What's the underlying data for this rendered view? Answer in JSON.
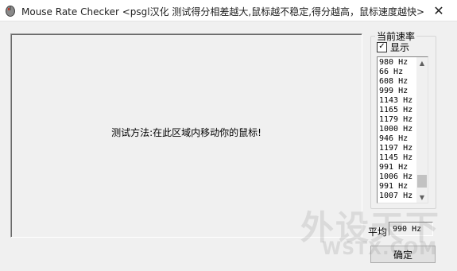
{
  "window": {
    "title": "Mouse Rate Checker <psgl汉化  测试得分相差越大,鼠标越不稳定,得分越高，鼠标速度越快>",
    "close_glyph": "✕",
    "app_icon": "mouse-app-icon"
  },
  "test_area": {
    "instruction": "测试方法:在此区域内移动你的鼠标!"
  },
  "rate_panel": {
    "group_label": "当前速率",
    "show_checkbox": {
      "label": "显示",
      "checked": true,
      "mark": "✓"
    },
    "rates": [
      "980 Hz",
      "66 Hz",
      "608 Hz",
      "999 Hz",
      "1143 Hz",
      "1165 Hz",
      "1179 Hz",
      "1000 Hz",
      "946 Hz",
      "1197 Hz",
      "1145 Hz",
      "991 Hz",
      "1006 Hz",
      "991 Hz",
      "1007 Hz"
    ],
    "scroll_up_glyph": "▲",
    "scroll_down_glyph": "▼"
  },
  "average": {
    "label": "平均",
    "value": "990 Hz"
  },
  "ok_button": {
    "label": "确定"
  },
  "watermark": {
    "main": "外设天下",
    "url": "WSTX.COM"
  }
}
